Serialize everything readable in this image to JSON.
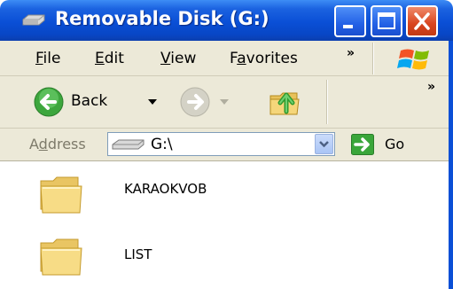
{
  "window": {
    "title": "Removable Disk (G:)",
    "title_icon": "removable-disk-icon"
  },
  "menu": {
    "items": [
      {
        "accel": "F",
        "rest": "ile"
      },
      {
        "accel": "E",
        "rest": "dit"
      },
      {
        "accel": "V",
        "rest": "iew"
      },
      {
        "pre": "F",
        "accel": "a",
        "rest": "vorites"
      }
    ],
    "more": "»"
  },
  "toolbar": {
    "back_label": "Back",
    "more": "»"
  },
  "address": {
    "label_pre": "A",
    "label_accel": "d",
    "label_rest": "dress",
    "value": "G:\\",
    "go_label": "Go"
  },
  "files": [
    {
      "name": "KARAOKVOB",
      "type": "folder"
    },
    {
      "name": "LIST",
      "type": "folder"
    }
  ],
  "colors": {
    "titlebar": "#0a4fd6",
    "chrome": "#ece9d8",
    "close_button": "#d8441e",
    "folder": "#f3d77a"
  }
}
